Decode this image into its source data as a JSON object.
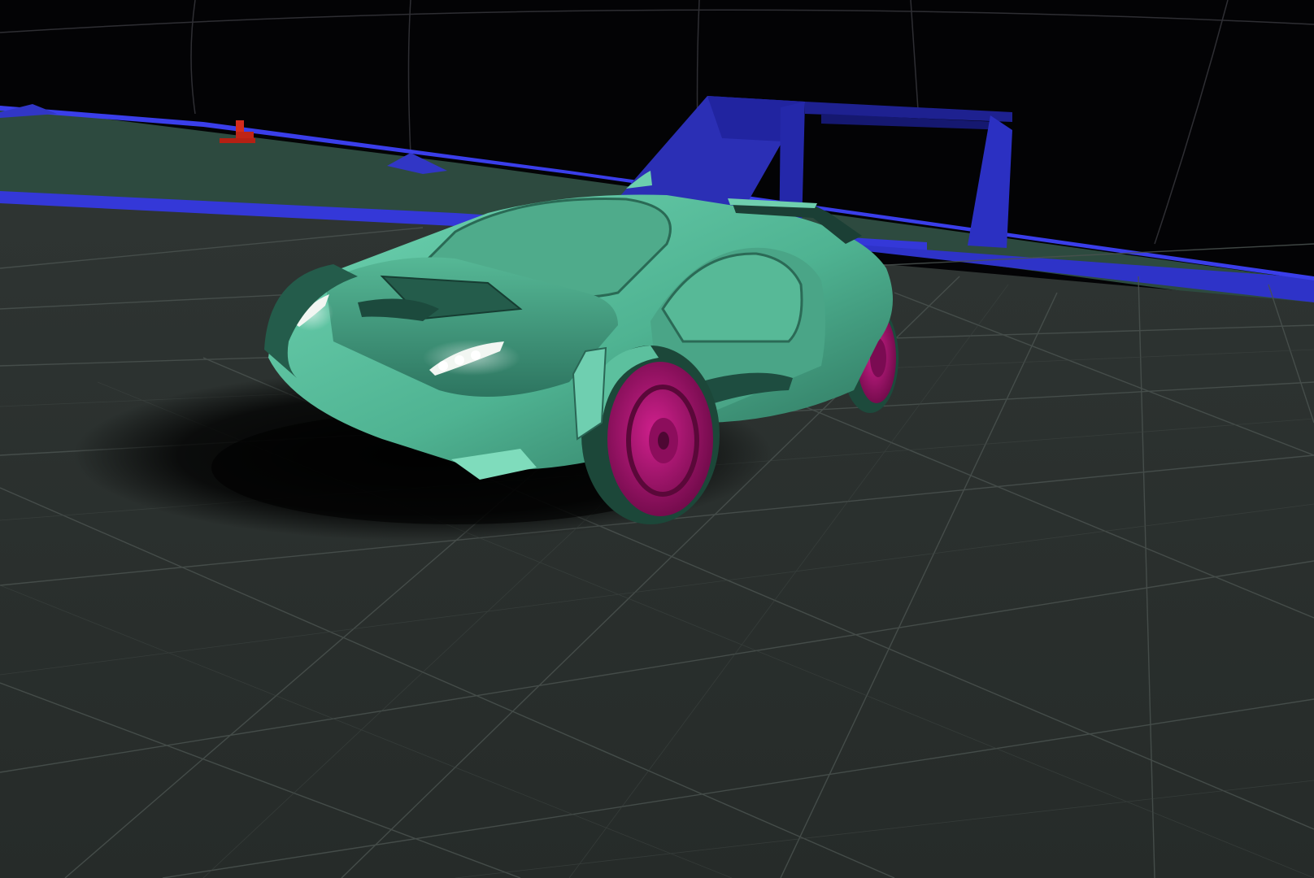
{
  "scene": {
    "type": "3d-game-viewport",
    "hud_text": [],
    "colors": {
      "sky": "#030305",
      "sky_grid": "#3a3a3f",
      "floor": "#303634",
      "floor_grid": "#596160",
      "far_floor": "#2e4a40",
      "blue_geometry": "#2b2fb5",
      "blue_edge": "#3440ff",
      "red_marker": "#d32b1c",
      "car_body": "#5fc8a6",
      "car_body_shadow": "#1e4d40",
      "car_highlight": "#8fe6c6",
      "wheel_rim": "#b01475",
      "wheel_tire": "#1d4a3c",
      "headlight": "#f2f6f2"
    },
    "objects": [
      {
        "name": "player-car",
        "color": "car_body",
        "rims": "wheel_rim"
      },
      {
        "name": "blue-ramp-arch",
        "color": "blue_geometry"
      },
      {
        "name": "blue-wall-strip",
        "color": "blue_geometry"
      },
      {
        "name": "red-marker",
        "color": "red_marker"
      }
    ]
  }
}
